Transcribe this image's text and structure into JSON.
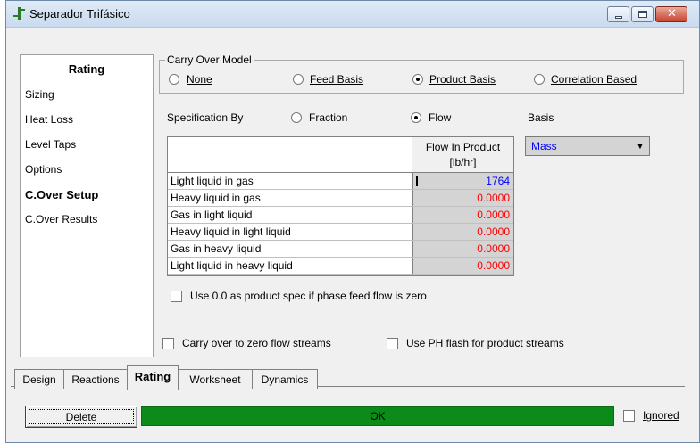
{
  "window": {
    "title": "Separador Trifásico"
  },
  "nav": {
    "header": "Rating",
    "items": [
      "Sizing",
      "Heat Loss",
      "Level Taps",
      "Options",
      "C.Over Setup",
      "C.Over Results"
    ],
    "active_item": "C.Over Setup"
  },
  "carry_over_model": {
    "legend": "Carry Over Model",
    "options": [
      "None",
      "Feed Basis",
      "Product Basis",
      "Correlation Based"
    ],
    "selected": "Product Basis"
  },
  "specification": {
    "label": "Specification By",
    "options": [
      "Fraction",
      "Flow"
    ],
    "selected": "Flow"
  },
  "basis": {
    "label": "Basis",
    "value": "Mass"
  },
  "grid": {
    "column_header": [
      "Flow In Product",
      "[lb/hr]"
    ],
    "rows": [
      {
        "name": "Light liquid in gas",
        "value": "1764"
      },
      {
        "name": "Heavy liquid in gas",
        "value": "0.0000"
      },
      {
        "name": "Gas in light liquid",
        "value": "0.0000"
      },
      {
        "name": "Heavy liquid in light liquid",
        "value": "0.0000"
      },
      {
        "name": "Gas in heavy liquid",
        "value": "0.0000"
      },
      {
        "name": "Light liquid in heavy liquid",
        "value": "0.0000"
      }
    ]
  },
  "checkboxes": {
    "use_zero_spec": "Use 0.0 as product spec if phase feed flow is zero",
    "carry_zero_flow": "Carry over to zero flow streams",
    "use_ph_flash": "Use PH flash for product streams"
  },
  "tabs": [
    "Design",
    "Reactions",
    "Rating",
    "Worksheet",
    "Dynamics"
  ],
  "active_tab": "Rating",
  "bottom": {
    "delete_label": "Delete",
    "status_text": "OK",
    "ignored_label": "Ignored"
  },
  "colors": {
    "status_green": "#0c8b1a",
    "value_red": "#ff0000",
    "value_blue": "#0000ff"
  }
}
